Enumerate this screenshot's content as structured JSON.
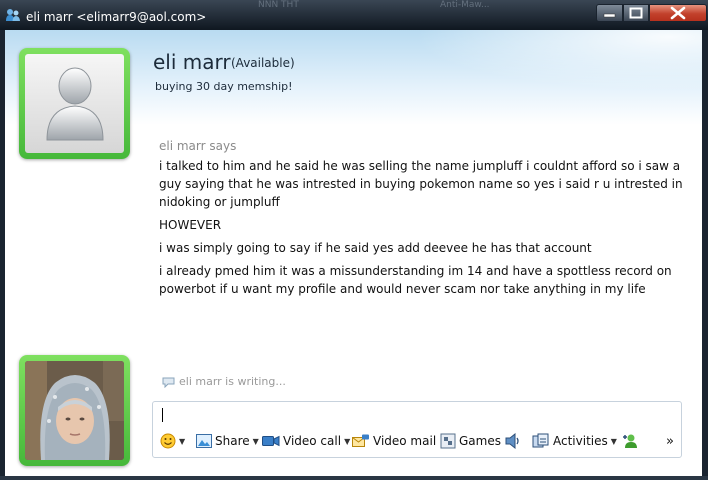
{
  "window": {
    "title": "eli marr <elimarr9@aol.com>",
    "bg_tab_1": "NNN THT",
    "bg_tab_2": "Anti-Maw..."
  },
  "contact": {
    "name": "eli marr",
    "status": "(Available)",
    "personal_message": "buying 30 day memship!"
  },
  "conversation": {
    "sender_line": "eli marr says",
    "messages": [
      "i talked to him and he said he was selling the name jumpluff i couldnt afford so i saw a guy saying that he was intrested in buying pokemon name so yes i said r u intrested in nidoking or jumpluff",
      "HOWEVER",
      "i was simply going to say if he said yes add deevee he has that account",
      "i already pmed him it was a missunderstanding im 14 and have a spottless record on powerbot if u want my profile and would never scam nor take anything in my life"
    ],
    "typing_indicator": "eli marr is writing..."
  },
  "compose": {
    "value": ""
  },
  "toolbar": {
    "share": "Share",
    "video_call": "Video call",
    "video_mail": "Video mail",
    "games": "Games",
    "activities": "Activities",
    "more": "»"
  },
  "colors": {
    "frame_green": "#46b83a",
    "header_blue": "#b9dbf1",
    "close_red": "#c2412c"
  }
}
